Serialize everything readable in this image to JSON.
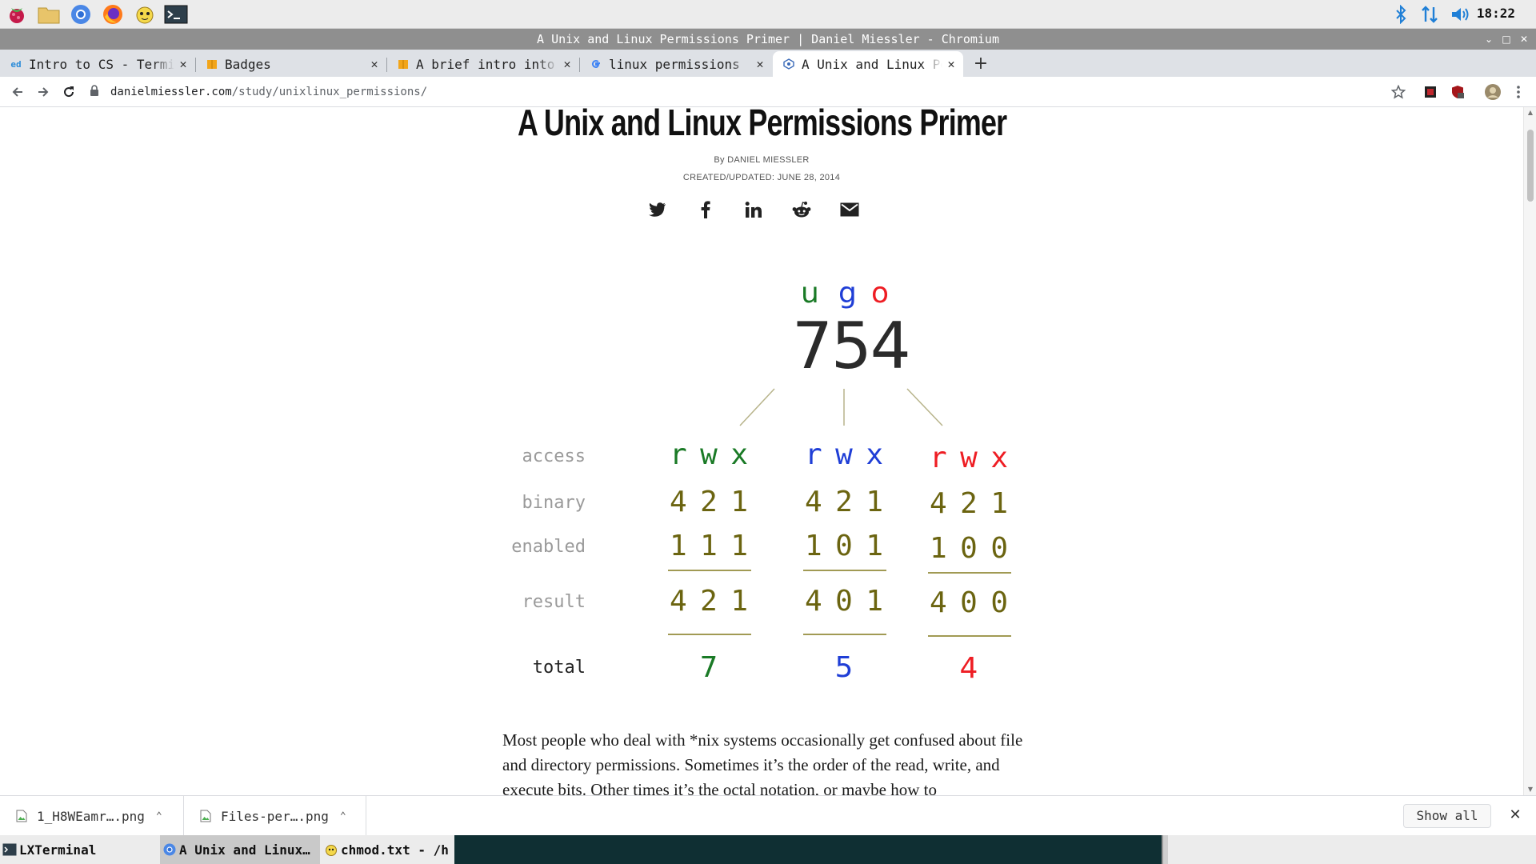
{
  "colors": {
    "user": "#1a7a26",
    "group": "#1f3ed6",
    "other": "#ee1d23",
    "olive": "#6b6410",
    "panel": "#ececec",
    "titlebar": "#8f8f8f",
    "tabstrip": "#dee1e6"
  },
  "system_panel": {
    "launchers": [
      "raspberry-icon",
      "file-manager-icon",
      "chromium-icon",
      "firefox-icon",
      "lxde-mascot-icon",
      "terminal-icon"
    ],
    "tray": [
      "bluetooth-icon",
      "network-arrows-icon",
      "volume-icon"
    ],
    "clock": "18:22"
  },
  "window": {
    "title": "A Unix and Linux Permissions Primer | Daniel Miessler - Chromium"
  },
  "tabs": [
    {
      "label": "Intro to CS - Terminal",
      "favicon": "ed"
    },
    {
      "label": "Badges",
      "favicon": "box-icon"
    },
    {
      "label": "A brief intro into",
      "favicon": "box-icon"
    },
    {
      "label": "linux permissions",
      "favicon": "G"
    },
    {
      "label": "A Unix and Linux Permissions Primer",
      "favicon": "dm-icon",
      "active": true
    }
  ],
  "toolbar": {
    "url_host": "danielmiessler.com",
    "url_path": "/study/unixlinux_permissions/"
  },
  "article": {
    "title": "A Unix and Linux Permissions Primer",
    "byline_prefix": "By",
    "author": "DANIEL MIESSLER",
    "updated": "CREATED/UPDATED: JUNE 28, 2014",
    "share": [
      "twitter-icon",
      "facebook-icon",
      "linkedin-icon",
      "reddit-icon",
      "email-icon"
    ],
    "paragraph": "Most people who deal with *nix systems occasionally get confused about file and directory permissions. Sometimes it’s the order of the read, write, and execute bits. Other times it’s the octal notation, or maybe how to"
  },
  "diagram": {
    "ugo": {
      "u": "u",
      "g": "g",
      "o": "o"
    },
    "octal": "754",
    "labels": {
      "access": "access",
      "binary": "binary",
      "enabled": "enabled",
      "result": "result",
      "total": "total"
    },
    "columns": [
      {
        "access": [
          "r",
          "w",
          "x"
        ],
        "binary": [
          "4",
          "2",
          "1"
        ],
        "enabled": [
          "1",
          "1",
          "1"
        ],
        "result": [
          "4",
          "2",
          "1"
        ],
        "total": "7"
      },
      {
        "access": [
          "r",
          "w",
          "x"
        ],
        "binary": [
          "4",
          "2",
          "1"
        ],
        "enabled": [
          "1",
          "0",
          "1"
        ],
        "result": [
          "4",
          "0",
          "1"
        ],
        "total": "5"
      },
      {
        "access": [
          "r",
          "w",
          "x"
        ],
        "binary": [
          "4",
          "2",
          "1"
        ],
        "enabled": [
          "1",
          "0",
          "0"
        ],
        "result": [
          "4",
          "0",
          "0"
        ],
        "total": "4"
      }
    ]
  },
  "downloads": {
    "items": [
      {
        "name": "1_H8WEamr….png"
      },
      {
        "name": "Files-per….png"
      }
    ],
    "show_all": "Show all"
  },
  "taskbar": {
    "tasks": [
      {
        "label": "LXTerminal"
      },
      {
        "label": "A Unix and Linux…",
        "active": true
      },
      {
        "label": "chmod.txt - /h"
      }
    ]
  }
}
